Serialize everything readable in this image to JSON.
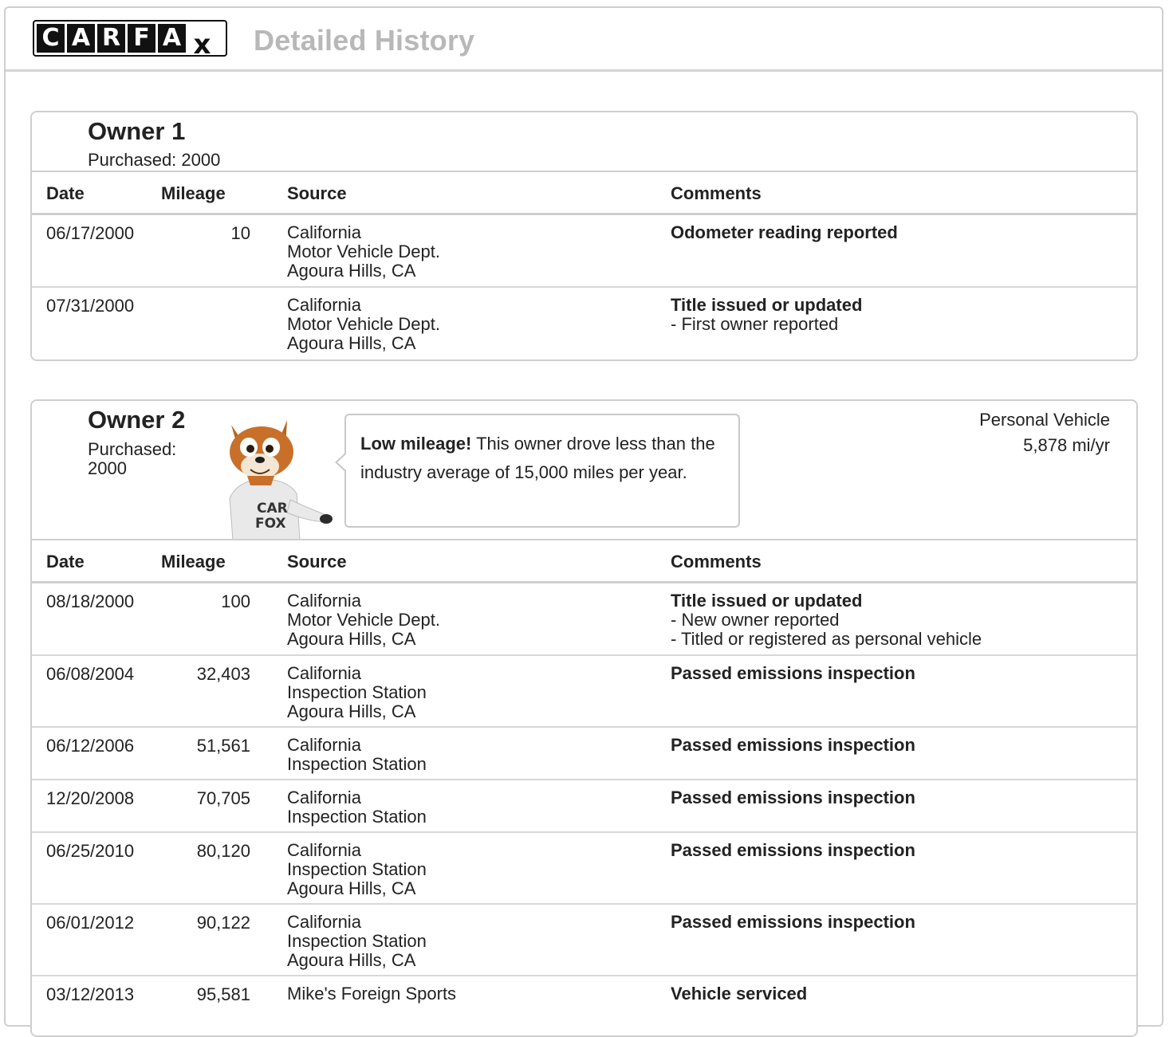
{
  "header": {
    "logo_letters": [
      "C",
      "A",
      "R",
      "F",
      "A",
      "x"
    ],
    "title": "Detailed History"
  },
  "columns": {
    "date": "Date",
    "mileage": "Mileage",
    "source": "Source",
    "comments": "Comments"
  },
  "owner1": {
    "title": "Owner 1",
    "purchased": "Purchased: 2000",
    "rows": [
      {
        "date": "06/17/2000",
        "mileage": "10",
        "source": [
          "California",
          "Motor Vehicle Dept.",
          "Agoura Hills, CA"
        ],
        "comment_main": "Odometer reading reported",
        "comment_details": []
      },
      {
        "date": "07/31/2000",
        "mileage": "",
        "source": [
          "California",
          "Motor Vehicle Dept.",
          "Agoura Hills, CA"
        ],
        "comment_main": "Title issued or updated",
        "comment_details": [
          "- First owner reported"
        ]
      }
    ]
  },
  "owner2": {
    "title": "Owner 2",
    "purchased_label": "Purchased:",
    "purchased_year": "2000",
    "fox_shirt": [
      "CAR",
      "FOX"
    ],
    "bubble": {
      "bold": "Low mileage!",
      "text": " This owner drove less than the industry average of 15,000 miles per year."
    },
    "vehicle_type": "Personal Vehicle",
    "annual_mileage": "5,878 mi/yr",
    "rows": [
      {
        "date": "08/18/2000",
        "mileage": "100",
        "source": [
          "California",
          "Motor Vehicle Dept.",
          "Agoura Hills, CA"
        ],
        "comment_main": "Title issued or updated",
        "comment_details": [
          "- New owner reported",
          "- Titled or registered as personal vehicle"
        ]
      },
      {
        "date": "06/08/2004",
        "mileage": "32,403",
        "source": [
          "California",
          "Inspection Station",
          "Agoura Hills, CA"
        ],
        "comment_main": "Passed emissions inspection",
        "comment_details": []
      },
      {
        "date": "06/12/2006",
        "mileage": "51,561",
        "source": [
          "California",
          "Inspection Station"
        ],
        "comment_main": "Passed emissions inspection",
        "comment_details": []
      },
      {
        "date": "12/20/2008",
        "mileage": "70,705",
        "source": [
          "California",
          "Inspection Station"
        ],
        "comment_main": "Passed emissions inspection",
        "comment_details": []
      },
      {
        "date": "06/25/2010",
        "mileage": "80,120",
        "source": [
          "California",
          "Inspection Station",
          "Agoura Hills, CA"
        ],
        "comment_main": "Passed emissions inspection",
        "comment_details": []
      },
      {
        "date": "06/01/2012",
        "mileage": "90,122",
        "source": [
          "California",
          "Inspection Station",
          "Agoura Hills, CA"
        ],
        "comment_main": "Passed emissions inspection",
        "comment_details": []
      },
      {
        "date": "03/12/2013",
        "mileage": "95,581",
        "source": [
          "Mike's Foreign Sports"
        ],
        "comment_main": "Vehicle serviced",
        "comment_details": []
      }
    ]
  }
}
